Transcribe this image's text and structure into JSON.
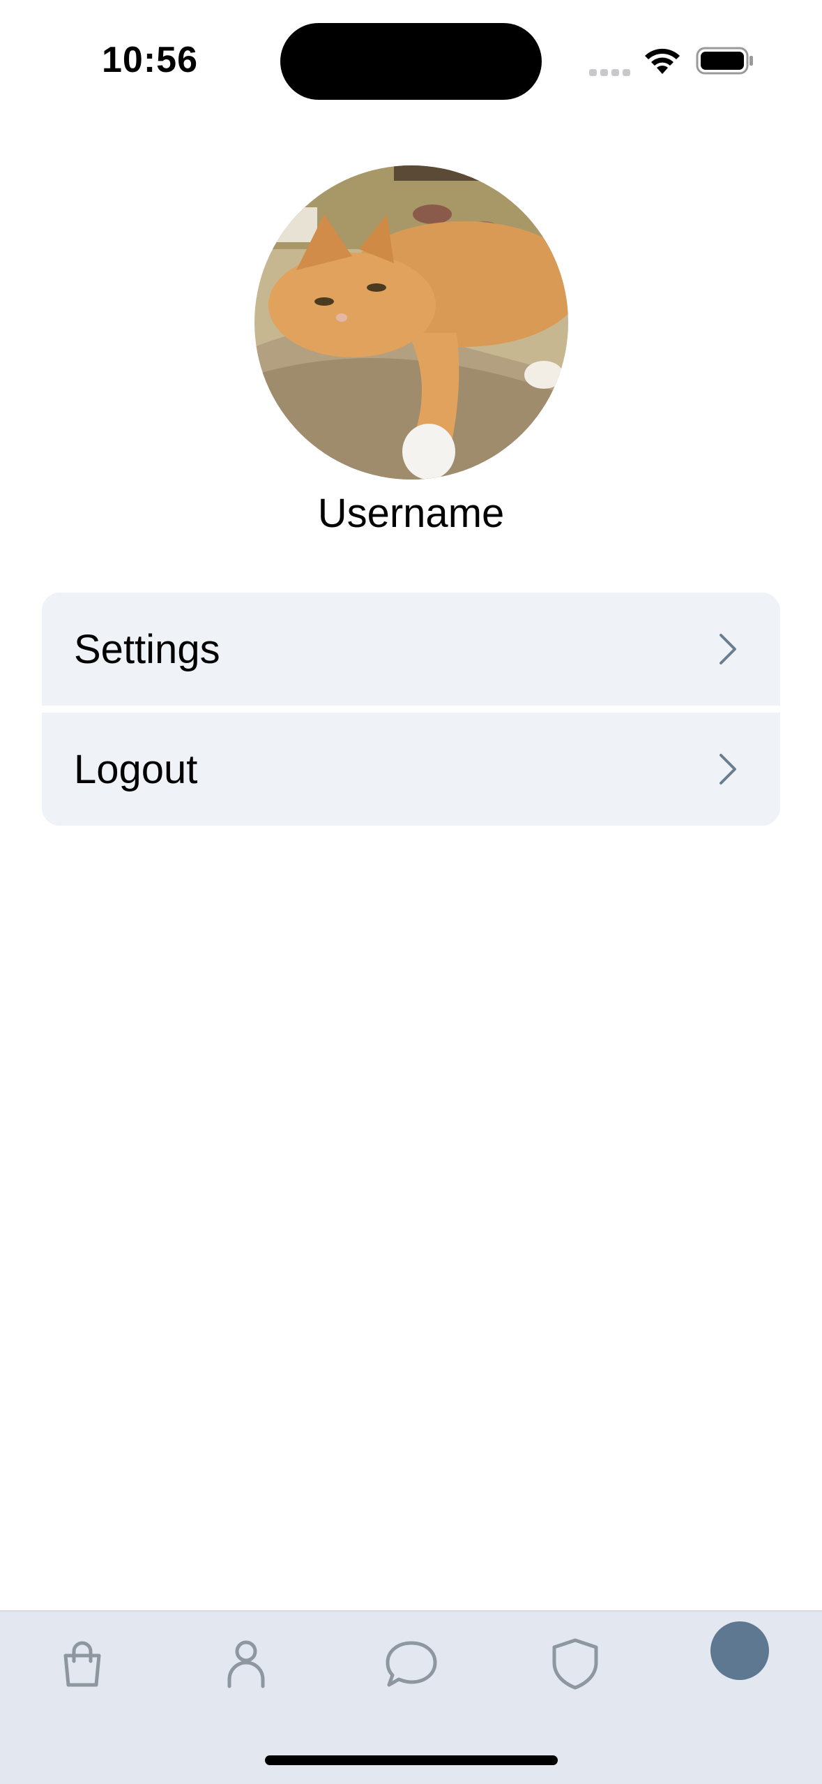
{
  "status_bar": {
    "time": "10:56"
  },
  "profile": {
    "username": "Username",
    "avatar_icon": "cat-photo"
  },
  "menu": {
    "items": [
      {
        "label": "Settings",
        "icon": "chevron-right-icon"
      },
      {
        "label": "Logout",
        "icon": "chevron-right-icon"
      }
    ]
  },
  "tab_bar": {
    "tabs": [
      {
        "icon": "shopping-bag-icon"
      },
      {
        "icon": "person-icon"
      },
      {
        "icon": "chat-bubble-icon"
      },
      {
        "icon": "shield-icon"
      },
      {
        "icon": "profile-avatar-icon",
        "active": true
      }
    ]
  },
  "colors": {
    "menu_background": "#eff2f7",
    "tab_bar_background": "#e3e8f0",
    "tab_icon": "#8e96a0",
    "active_tab": "#5e7891",
    "chevron": "#6b7d90"
  }
}
